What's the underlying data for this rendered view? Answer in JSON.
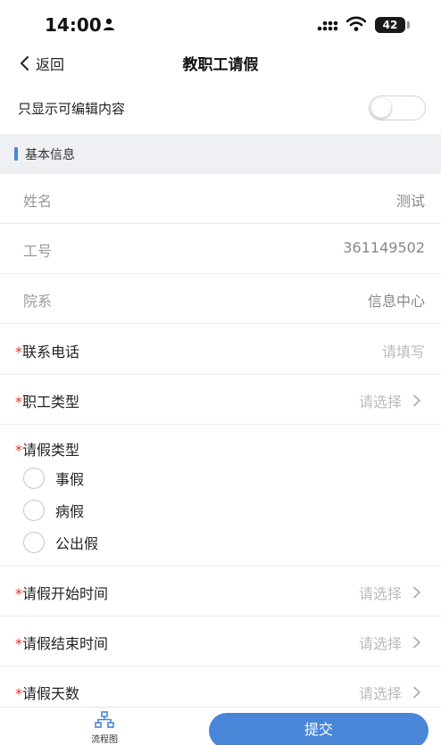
{
  "status_bar": {
    "time": "14:00",
    "battery": "42"
  },
  "nav": {
    "back_label": "返回",
    "title": "教职工请假"
  },
  "toggle": {
    "label": "只显示可编辑内容",
    "on": false
  },
  "section": {
    "title": "基本信息"
  },
  "fields": {
    "name": {
      "label": "姓名",
      "value": "测试"
    },
    "staff_id": {
      "label": "工号",
      "value": "361149502"
    },
    "department": {
      "label": "院系",
      "value": "信息中心"
    },
    "phone": {
      "label": "联系电话",
      "placeholder": "请填写"
    },
    "staff_type": {
      "label": "职工类型",
      "placeholder": "请选择"
    },
    "leave_type": {
      "label": "请假类型",
      "options": [
        "事假",
        "病假",
        "公出假"
      ]
    },
    "start_time": {
      "label": "请假开始时间",
      "placeholder": "请选择"
    },
    "end_time": {
      "label": "请假结束时间",
      "placeholder": "请选择"
    },
    "days": {
      "label": "请假天数",
      "placeholder": "请选择"
    }
  },
  "required_mark": "*",
  "bottom": {
    "flow_label": "流程图",
    "submit_label": "提交"
  },
  "colors": {
    "accent": "#4a86d8",
    "required": "#d9362b",
    "section_bg": "#eef0f4"
  }
}
